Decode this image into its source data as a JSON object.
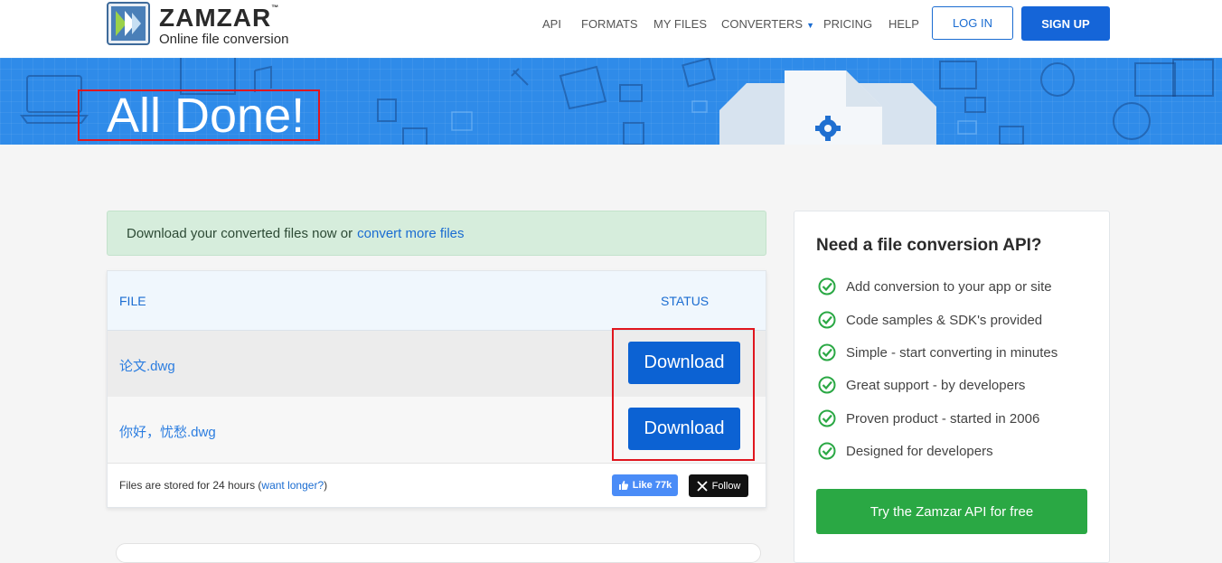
{
  "brand": {
    "name": "ZAMZAR",
    "tm": "™",
    "tagline": "Online file conversion"
  },
  "nav": {
    "items": [
      "API",
      "FORMATS",
      "MY FILES",
      "CONVERTERS",
      "PRICING",
      "HELP"
    ],
    "login": "LOG IN",
    "signup": "SIGN UP"
  },
  "banner": {
    "title": "All Done!"
  },
  "alert": {
    "text": "Download your converted files now or",
    "link": "convert more files"
  },
  "files_table": {
    "headers": {
      "file": "FILE",
      "status": "STATUS"
    },
    "rows": [
      {
        "name": "论文.dwg",
        "action": "Download"
      },
      {
        "name": "你好，忧愁.dwg",
        "action": "Download"
      }
    ],
    "footer": {
      "stored_prefix": "Files are stored for 24 hours (",
      "stored_link": "want longer?",
      "stored_suffix": ")"
    },
    "social": {
      "like": "Like 77k",
      "follow": "Follow"
    }
  },
  "api_panel": {
    "title": "Need a file conversion API?",
    "features": [
      "Add conversion to your app or site",
      "Code samples & SDK's provided",
      "Simple - start converting in minutes",
      "Great support - by developers",
      "Proven product - started in 2006",
      "Designed for developers"
    ],
    "cta": "Try the Zamzar API for free"
  },
  "colors": {
    "primary": "#1565d8",
    "banner": "#2f8be9",
    "success": "#2aa844",
    "highlight": "#e0161e"
  }
}
